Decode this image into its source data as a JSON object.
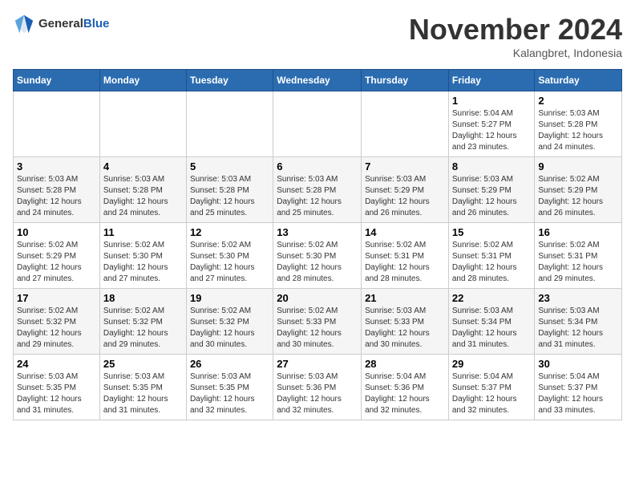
{
  "logo": {
    "general": "General",
    "blue": "Blue"
  },
  "title": "November 2024",
  "location": "Kalangbret, Indonesia",
  "days_of_week": [
    "Sunday",
    "Monday",
    "Tuesday",
    "Wednesday",
    "Thursday",
    "Friday",
    "Saturday"
  ],
  "weeks": [
    [
      {
        "day": "",
        "info": ""
      },
      {
        "day": "",
        "info": ""
      },
      {
        "day": "",
        "info": ""
      },
      {
        "day": "",
        "info": ""
      },
      {
        "day": "",
        "info": ""
      },
      {
        "day": "1",
        "info": "Sunrise: 5:04 AM\nSunset: 5:27 PM\nDaylight: 12 hours\nand 23 minutes."
      },
      {
        "day": "2",
        "info": "Sunrise: 5:03 AM\nSunset: 5:28 PM\nDaylight: 12 hours\nand 24 minutes."
      }
    ],
    [
      {
        "day": "3",
        "info": "Sunrise: 5:03 AM\nSunset: 5:28 PM\nDaylight: 12 hours\nand 24 minutes."
      },
      {
        "day": "4",
        "info": "Sunrise: 5:03 AM\nSunset: 5:28 PM\nDaylight: 12 hours\nand 24 minutes."
      },
      {
        "day": "5",
        "info": "Sunrise: 5:03 AM\nSunset: 5:28 PM\nDaylight: 12 hours\nand 25 minutes."
      },
      {
        "day": "6",
        "info": "Sunrise: 5:03 AM\nSunset: 5:28 PM\nDaylight: 12 hours\nand 25 minutes."
      },
      {
        "day": "7",
        "info": "Sunrise: 5:03 AM\nSunset: 5:29 PM\nDaylight: 12 hours\nand 26 minutes."
      },
      {
        "day": "8",
        "info": "Sunrise: 5:03 AM\nSunset: 5:29 PM\nDaylight: 12 hours\nand 26 minutes."
      },
      {
        "day": "9",
        "info": "Sunrise: 5:02 AM\nSunset: 5:29 PM\nDaylight: 12 hours\nand 26 minutes."
      }
    ],
    [
      {
        "day": "10",
        "info": "Sunrise: 5:02 AM\nSunset: 5:29 PM\nDaylight: 12 hours\nand 27 minutes."
      },
      {
        "day": "11",
        "info": "Sunrise: 5:02 AM\nSunset: 5:30 PM\nDaylight: 12 hours\nand 27 minutes."
      },
      {
        "day": "12",
        "info": "Sunrise: 5:02 AM\nSunset: 5:30 PM\nDaylight: 12 hours\nand 27 minutes."
      },
      {
        "day": "13",
        "info": "Sunrise: 5:02 AM\nSunset: 5:30 PM\nDaylight: 12 hours\nand 28 minutes."
      },
      {
        "day": "14",
        "info": "Sunrise: 5:02 AM\nSunset: 5:31 PM\nDaylight: 12 hours\nand 28 minutes."
      },
      {
        "day": "15",
        "info": "Sunrise: 5:02 AM\nSunset: 5:31 PM\nDaylight: 12 hours\nand 28 minutes."
      },
      {
        "day": "16",
        "info": "Sunrise: 5:02 AM\nSunset: 5:31 PM\nDaylight: 12 hours\nand 29 minutes."
      }
    ],
    [
      {
        "day": "17",
        "info": "Sunrise: 5:02 AM\nSunset: 5:32 PM\nDaylight: 12 hours\nand 29 minutes."
      },
      {
        "day": "18",
        "info": "Sunrise: 5:02 AM\nSunset: 5:32 PM\nDaylight: 12 hours\nand 29 minutes."
      },
      {
        "day": "19",
        "info": "Sunrise: 5:02 AM\nSunset: 5:32 PM\nDaylight: 12 hours\nand 30 minutes."
      },
      {
        "day": "20",
        "info": "Sunrise: 5:02 AM\nSunset: 5:33 PM\nDaylight: 12 hours\nand 30 minutes."
      },
      {
        "day": "21",
        "info": "Sunrise: 5:03 AM\nSunset: 5:33 PM\nDaylight: 12 hours\nand 30 minutes."
      },
      {
        "day": "22",
        "info": "Sunrise: 5:03 AM\nSunset: 5:34 PM\nDaylight: 12 hours\nand 31 minutes."
      },
      {
        "day": "23",
        "info": "Sunrise: 5:03 AM\nSunset: 5:34 PM\nDaylight: 12 hours\nand 31 minutes."
      }
    ],
    [
      {
        "day": "24",
        "info": "Sunrise: 5:03 AM\nSunset: 5:35 PM\nDaylight: 12 hours\nand 31 minutes."
      },
      {
        "day": "25",
        "info": "Sunrise: 5:03 AM\nSunset: 5:35 PM\nDaylight: 12 hours\nand 31 minutes."
      },
      {
        "day": "26",
        "info": "Sunrise: 5:03 AM\nSunset: 5:35 PM\nDaylight: 12 hours\nand 32 minutes."
      },
      {
        "day": "27",
        "info": "Sunrise: 5:03 AM\nSunset: 5:36 PM\nDaylight: 12 hours\nand 32 minutes."
      },
      {
        "day": "28",
        "info": "Sunrise: 5:04 AM\nSunset: 5:36 PM\nDaylight: 12 hours\nand 32 minutes."
      },
      {
        "day": "29",
        "info": "Sunrise: 5:04 AM\nSunset: 5:37 PM\nDaylight: 12 hours\nand 32 minutes."
      },
      {
        "day": "30",
        "info": "Sunrise: 5:04 AM\nSunset: 5:37 PM\nDaylight: 12 hours\nand 33 minutes."
      }
    ]
  ]
}
